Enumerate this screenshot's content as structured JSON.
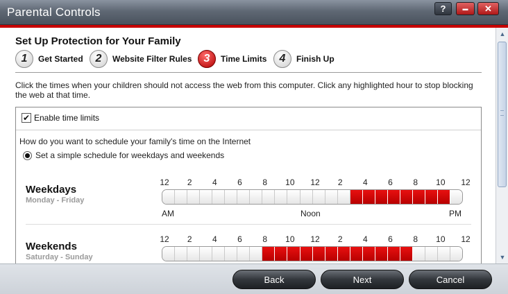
{
  "window": {
    "title": "Parental Controls",
    "help_label": "?",
    "minimize_label": "▬",
    "close_label": "✕"
  },
  "wizard": {
    "heading": "Set Up Protection for Your Family",
    "steps": [
      {
        "num": "1",
        "label": "Get Started",
        "active": false
      },
      {
        "num": "2",
        "label": "Website Filter Rules",
        "active": false
      },
      {
        "num": "3",
        "label": "Time Limits",
        "active": true
      },
      {
        "num": "4",
        "label": "Finish Up",
        "active": false
      }
    ],
    "instructions": "Click the times when your children should not access the web from this computer. Click any highlighted hour to stop blocking the web at that time."
  },
  "time_limits": {
    "enable_label": "Enable time limits",
    "enabled": true,
    "question": "How do you want to schedule your family's time on the Internet",
    "simple_schedule_label": "Set a simple schedule for weekdays and weekends",
    "tick_labels": [
      "12",
      "2",
      "4",
      "6",
      "8",
      "10",
      "12",
      "2",
      "4",
      "6",
      "8",
      "10",
      "12"
    ],
    "am_label": "AM",
    "noon_label": "Noon",
    "pm_label": "PM",
    "weekdays": {
      "name": "Weekdays",
      "subtitle": "Monday - Friday",
      "blocked_hours": [
        15,
        16,
        17,
        18,
        19,
        20,
        21,
        22
      ]
    },
    "weekends": {
      "name": "Weekends",
      "subtitle": "Saturday - Sunday",
      "blocked_hours": [
        8,
        9,
        10,
        11,
        12,
        13,
        14,
        15,
        16,
        17,
        18,
        19
      ]
    }
  },
  "footer": {
    "back_label": "Back",
    "next_label": "Next",
    "cancel_label": "Cancel"
  },
  "colors": {
    "accent": "#c70000",
    "blocked": "#d60000"
  }
}
